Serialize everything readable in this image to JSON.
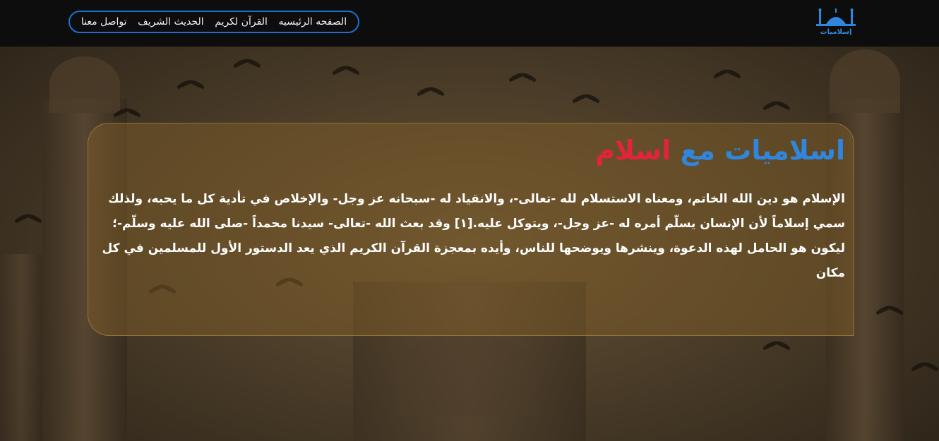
{
  "nav": {
    "items": [
      {
        "label": "الصفحه الرئيسيه"
      },
      {
        "label": "القرآن لكريم"
      },
      {
        "label": "الحديث الشريف"
      },
      {
        "label": "تواصل معنا"
      }
    ]
  },
  "logo": {
    "text": "إسلاميات",
    "icon": "mosque-icon"
  },
  "hero": {
    "title_part1": "اسلاميات مع",
    "title_part2": "اسلام",
    "paragraph": "الإسلام هو دين الله الخاتم، ومعناه الاستسلام لله -تعالى-، والانقياد له -سبحانه عز وجل- والإخلاص في تأدية كل ما يحبه، ولذلك سمي إسلاماً لأن الإنسان يسلّم أمره له -عز وجل-، ويتوكل عليه.[١] وقد بعث الله -تعالى- سيدنا محمداً -صلى الله عليه وسلّم-؛ ليكون هو الحامل لهذه الدعوة، وينشرها ويوضحها للناس، وأيده بمعجزة القرآن الكريم الذي يعد الدستور الأول للمسلمين في كل مكان"
  },
  "colors": {
    "topbar": "#0d0d0d",
    "nav_border": "#1e6fd0",
    "title_blue": "#2f86dc",
    "title_red": "#e0243a"
  }
}
